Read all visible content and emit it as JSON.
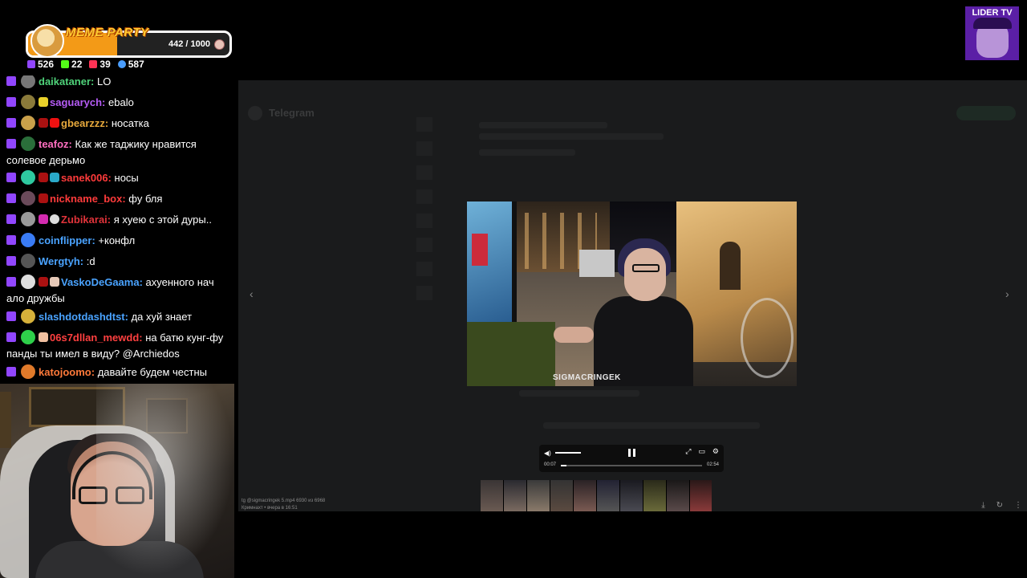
{
  "overlay": {
    "meme_widget": {
      "title": "MEME PARTY",
      "progress_text": "442 / 1000",
      "progress": 0.442,
      "progress_color": "#f39a17"
    },
    "stats": [
      {
        "icon": "twitch-icon",
        "value": "526",
        "color": "#9146ff"
      },
      {
        "icon": "kick-icon",
        "value": "22",
        "color": "#53fc18"
      },
      {
        "icon": "vk-live-icon",
        "value": "39",
        "color": "#ff3355"
      },
      {
        "icon": "viewers-icon",
        "value": "587",
        "color": "#4a9eff"
      }
    ],
    "streamer_logo": "LIDER TV"
  },
  "chat": {
    "messages": [
      {
        "user": "daikataner:",
        "text": "LO",
        "user_color": "#4fd37a",
        "avatar": "#777"
      },
      {
        "user": "saguarych:",
        "text": "ebalo",
        "user_color": "#b55cf5",
        "avatar": "#8a7a3a"
      },
      {
        "user": "gbearzzz:",
        "text": "носатка",
        "user_color": "#e7a93c",
        "avatar": "#c9a04a"
      },
      {
        "user": "teafoz:",
        "text": "Как же таджику нравится солевое дерьмо",
        "user_color": "#ff6fc1",
        "avatar": "#2a6e3a"
      },
      {
        "user": "sanek006:",
        "text": "носы",
        "user_color": "#ff3b3b",
        "avatar": "#2ec9a0"
      },
      {
        "user": "nickname_box:",
        "text": "фу бля",
        "user_color": "#ff3b3b",
        "avatar": "#6a4a5a"
      },
      {
        "user": "Zubikarai:",
        "text": "я хуею с этой дуры..",
        "user_color": "#e0333a",
        "avatar": "#999"
      },
      {
        "user": "coinflipper:",
        "text": "+конфл",
        "user_color": "#4aa3ff",
        "avatar": "#3a7cf5"
      },
      {
        "user": "Wergtyh:",
        "text": ":d",
        "user_color": "#4aa3ff",
        "avatar": "#555"
      },
      {
        "user": "VaskoDeGaama:",
        "text": "ахуенного нач ало дружбы",
        "user_color": "#4aa3ff",
        "avatar": "#ddd"
      },
      {
        "user": "slashdotdashdtst:",
        "text": "да хуй знает",
        "user_color": "#4aa3ff",
        "avatar": "#d6b13a"
      },
      {
        "user": "06s7dllan_mewdd:",
        "text": "на батю кунг-фу панды ты имел в виду? @Archiedos",
        "user_color": "#ff4040",
        "avatar": "#2ed04a"
      },
      {
        "user": "katojoomo:",
        "text": "давайте будем честны",
        "user_color": "#ff7a3a",
        "avatar": "#e07a2a"
      }
    ]
  },
  "telegram": {
    "title": "Telegram",
    "video_watermark": "SIGMACRINGEK",
    "caption_line1": "tg @sigmacringek 5.mp4 6930 из 6968",
    "caption_line2": "Кримнахт • вчера в 16:51",
    "player": {
      "current_time": "00:07",
      "total_time": "02:54",
      "progress": 0.04,
      "volume": 1
    }
  }
}
